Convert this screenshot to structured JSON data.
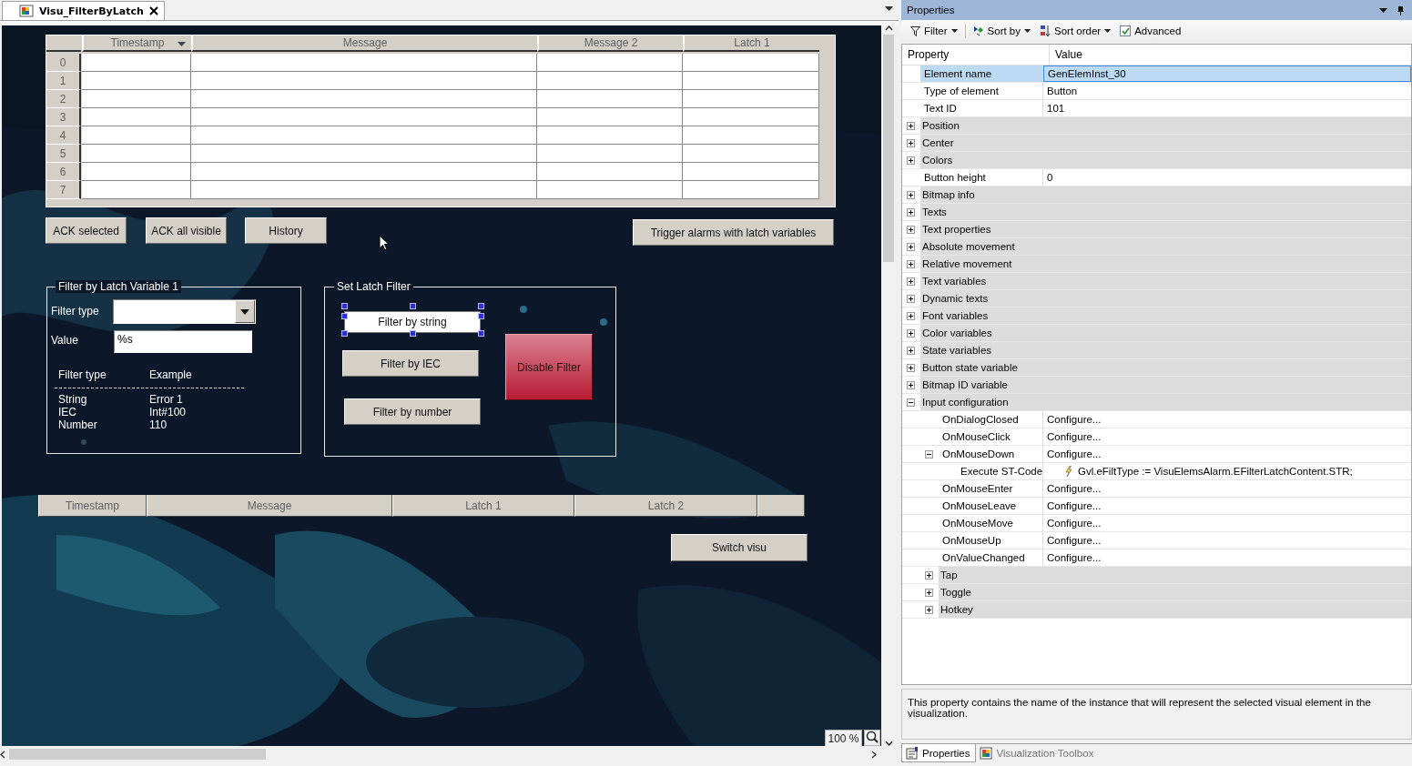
{
  "editor_tab": {
    "title": "Visu_FilterByLatch",
    "selected": true
  },
  "alarm_table": {
    "columns": [
      {
        "label": "Timestamp",
        "sorted": true
      },
      {
        "label": "Message",
        "sorted": false
      },
      {
        "label": "Message 2",
        "sorted": false
      },
      {
        "label": "Latch 1",
        "sorted": false
      }
    ],
    "row_numbers": [
      "0",
      "1",
      "2",
      "3",
      "4",
      "5",
      "6",
      "7"
    ]
  },
  "action_buttons": [
    {
      "label": "ACK selected"
    },
    {
      "label": "ACK all visible"
    },
    {
      "label": "History"
    },
    {
      "label": "Trigger alarms with latch variables"
    }
  ],
  "filter_group": {
    "title": "Filter by Latch Variable 1",
    "filter_type_label": "Filter type",
    "value_label": "Value",
    "value": "%s",
    "legend_headers": [
      "Filter type",
      "Example"
    ],
    "legend_rows": [
      [
        "String",
        "Error 1"
      ],
      [
        "IEC",
        "Int#100"
      ],
      [
        "Number",
        "110"
      ]
    ]
  },
  "set_latch_filter": {
    "title": "Set Latch Filter",
    "buttons": [
      {
        "label": "Filter by string",
        "selected": true
      },
      {
        "label": "Filter by IEC",
        "selected": false
      },
      {
        "label": "Filter by number",
        "selected": false
      }
    ],
    "disable_button": "Disable Filter"
  },
  "latch_table": {
    "columns": [
      "Timestamp",
      "Message",
      "Latch 1",
      "Latch 2"
    ]
  },
  "switch_button": "Switch visu",
  "zoom": "100 %",
  "properties": {
    "title": "Properties",
    "toolbar": {
      "filter": "Filter",
      "sort_by": "Sort by",
      "sort_order": "Sort order",
      "advanced": {
        "label": "Advanced",
        "checked": true
      }
    },
    "columns": [
      "Property",
      "Value"
    ],
    "rows": [
      {
        "name": "Element name",
        "kind": "property",
        "value": "GenElemInst_30",
        "selected": true
      },
      {
        "name": "Type of element",
        "kind": "property",
        "value": "Button",
        "selected": false
      },
      {
        "name": "Text ID",
        "kind": "property",
        "value": "101",
        "selected": false
      },
      {
        "name": "Position",
        "kind": "category",
        "expanded": false,
        "selected": false
      },
      {
        "name": "Center",
        "kind": "category",
        "expanded": false,
        "selected": false
      },
      {
        "name": "Colors",
        "kind": "category",
        "expanded": false,
        "selected": false
      },
      {
        "name": "Button height",
        "kind": "property",
        "value": "0",
        "selected": false
      },
      {
        "name": "Bitmap info",
        "kind": "category",
        "expanded": false,
        "selected": false
      },
      {
        "name": "Texts",
        "kind": "category",
        "expanded": false,
        "selected": false
      },
      {
        "name": "Text properties",
        "kind": "category",
        "expanded": false,
        "selected": false
      },
      {
        "name": "Absolute movement",
        "kind": "category",
        "expanded": false,
        "selected": false
      },
      {
        "name": "Relative movement",
        "kind": "category",
        "expanded": false,
        "selected": false
      },
      {
        "name": "Text variables",
        "kind": "category",
        "expanded": false,
        "selected": false
      },
      {
        "name": "Dynamic texts",
        "kind": "category",
        "expanded": false,
        "selected": false
      },
      {
        "name": "Font variables",
        "kind": "category",
        "expanded": false,
        "selected": false
      },
      {
        "name": "Color variables",
        "kind": "category",
        "expanded": false,
        "selected": false
      },
      {
        "name": "State variables",
        "kind": "category",
        "expanded": false,
        "selected": false
      },
      {
        "name": "Button state variable",
        "kind": "category",
        "expanded": false,
        "selected": false
      },
      {
        "name": "Bitmap ID variable",
        "kind": "category",
        "expanded": false,
        "selected": false
      },
      {
        "name": "Input configuration",
        "kind": "category",
        "expanded": true,
        "selected": false,
        "children": [
          {
            "name": "OnDialogClosed",
            "kind": "property",
            "value": "Configure...",
            "selected": false
          },
          {
            "name": "OnMouseClick",
            "kind": "property",
            "value": "Configure...",
            "selected": false
          },
          {
            "name": "OnMouseDown",
            "kind": "property",
            "value": "Configure...",
            "expanded": true,
            "selected": false,
            "children": [
              {
                "name": "Execute ST-Code",
                "kind": "action",
                "value": "Gvl.eFiltType := VisuElemsAlarm.EFilterLatchContent.STR;",
                "selected": false
              }
            ]
          },
          {
            "name": "OnMouseEnter",
            "kind": "property",
            "value": "Configure...",
            "selected": false
          },
          {
            "name": "OnMouseLeave",
            "kind": "property",
            "value": "Configure...",
            "selected": false
          },
          {
            "name": "OnMouseMove",
            "kind": "property",
            "value": "Configure...",
            "selected": false
          },
          {
            "name": "OnMouseUp",
            "kind": "property",
            "value": "Configure...",
            "selected": false
          },
          {
            "name": "OnValueChanged",
            "kind": "property",
            "value": "Configure...",
            "selected": false
          },
          {
            "name": "Tap",
            "kind": "category",
            "expanded": false,
            "selected": false
          },
          {
            "name": "Toggle",
            "kind": "category",
            "expanded": false,
            "selected": false
          },
          {
            "name": "Hotkey",
            "kind": "category",
            "expanded": false,
            "selected": false
          }
        ]
      }
    ],
    "description": "This property contains the name of the instance that will represent the selected visual element in the visualization.",
    "bottom_tabs": [
      {
        "label": "Properties",
        "selected": true
      },
      {
        "label": "Visualization Toolbox",
        "selected": false
      }
    ]
  }
}
